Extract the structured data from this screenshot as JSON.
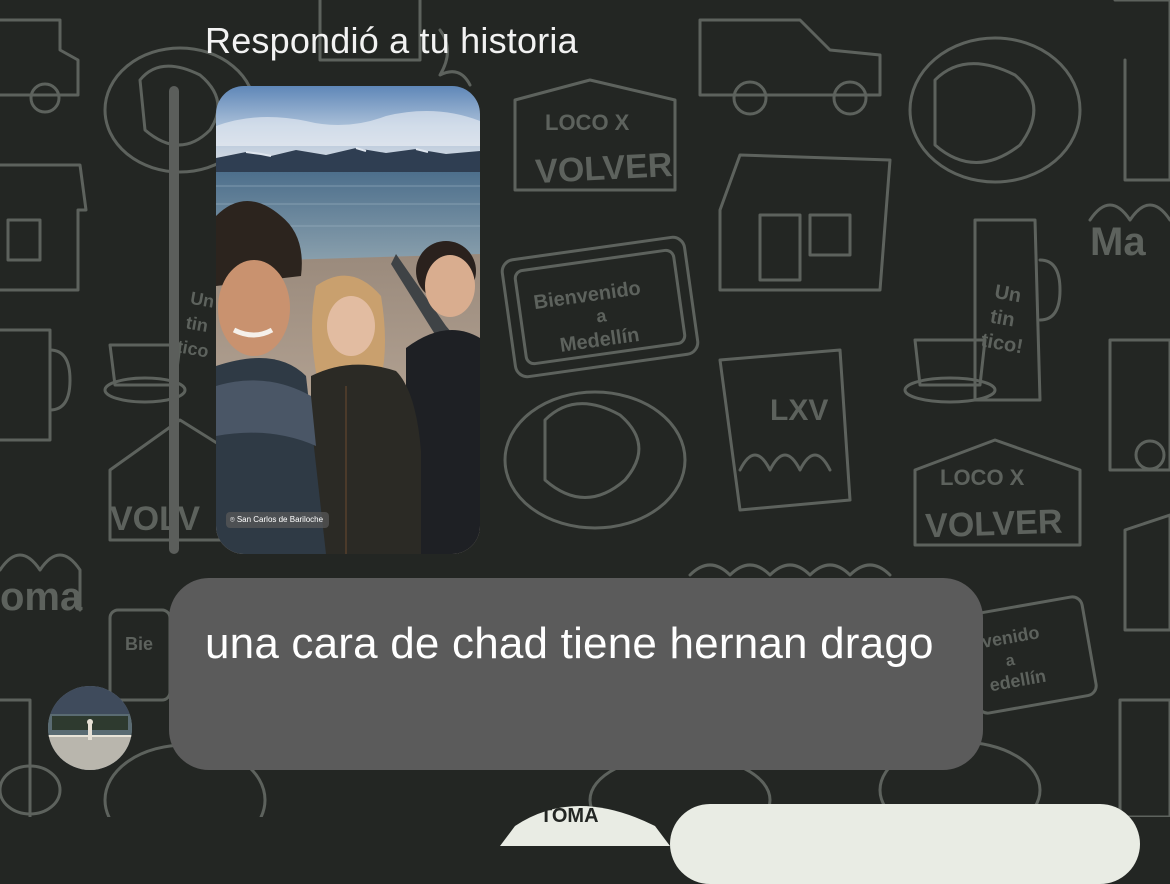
{
  "reply": {
    "label": "Respondió a tu historia"
  },
  "story": {
    "location_label": "San Carlos de Bariloche",
    "location_icon": "location-pin-icon"
  },
  "message": {
    "text": "una cara de chad tiene hernan drago"
  },
  "wallpaper": {
    "sticker_texts": [
      "LOCO X VOLVER",
      "Bienvenido a Medellín",
      "Un tintico!",
      "LXV"
    ],
    "background_color": "#232623",
    "line_color": "#5d625d"
  },
  "colors": {
    "bubble": "#5b5b5b",
    "reply_bar": "#5b5e5b",
    "text": "#ffffff"
  }
}
